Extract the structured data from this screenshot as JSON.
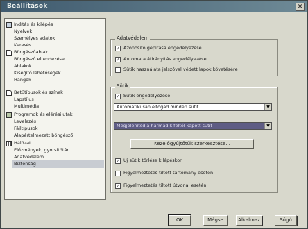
{
  "window": {
    "title": "Beállítások"
  },
  "sidebar": {
    "items": [
      {
        "label": "Indítás és kilépés",
        "icon": "computer-icon"
      },
      {
        "label": "Nyelvek"
      },
      {
        "label": "Személyes adatok"
      },
      {
        "label": "Keresés"
      },
      {
        "label": "Böngészőablak",
        "icon": "page-icon"
      },
      {
        "label": "Böngésző elrendezése"
      },
      {
        "label": "Ablakok"
      },
      {
        "label": "Kisegítő lehetőségek"
      },
      {
        "label": "Hangok"
      },
      {
        "label": "Betűtípusok és színek",
        "icon": "page-icon"
      },
      {
        "label": "Lapstílus"
      },
      {
        "label": "Multimédia"
      },
      {
        "label": "Programok és elérési utak",
        "icon": "puzzle-icon"
      },
      {
        "label": "Levelezés"
      },
      {
        "label": "Fájltípusok"
      },
      {
        "label": "Alapértelmezett böngésző"
      },
      {
        "label": "Hálózat",
        "icon": "grid-icon"
      },
      {
        "label": "Előzmények, gyorsítótár"
      },
      {
        "label": "Adatvédelem"
      },
      {
        "label": "Biztonság",
        "selected": true
      }
    ]
  },
  "adatvedelem": {
    "label": "Adatvédelem",
    "options": [
      {
        "label": "Azonosító gépírása engedélyezése",
        "checked": true
      },
      {
        "label": "Automata átirányítás engedélyezése",
        "checked": true
      },
      {
        "label": "Sütik használata jelszóval védett lapok követésére",
        "checked": false
      }
    ]
  },
  "sutik": {
    "label": "Sütik",
    "enable_label": "Sütik engedélyezése",
    "enable_checked": true,
    "policy_value": "Automatikusan elfogad minden sütit",
    "thirdparty_value": "Megjelenítsd a harmadik féltől kapott sütit",
    "manage_button": "Kezelőgyűjtőtűk szerkesztése...",
    "options": [
      {
        "label": "Új sütik törlése kilépéskor",
        "checked": true
      },
      {
        "label": "Figyelmeztetés tiltott tartomány esetén",
        "checked": false
      },
      {
        "label": "Figyelmeztetés tiltott útvonal esetén",
        "checked": true
      }
    ]
  },
  "buttons": {
    "ok": "OK",
    "cancel": "Mégse",
    "apply": "Alkalmaz",
    "help": "Súgó"
  }
}
